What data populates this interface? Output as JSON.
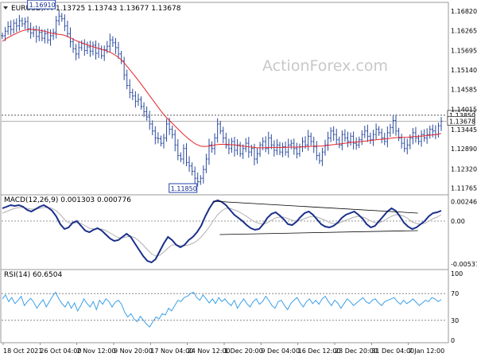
{
  "symbol_header": "EURUSD,H4  1.13725 1.13743 1.13677 1.13678",
  "watermark": "ActionForex.com",
  "colors": {
    "price": "#2b4a9e",
    "ma": "#e8242a",
    "macd_line": "#1a2f8a",
    "macd_signal": "#b0b0b0",
    "rsi": "#3aa0e8",
    "trendline": "#000000",
    "label_box": "#2244aa"
  },
  "chart_data": [
    {
      "type": "line",
      "panel": "price",
      "title": "EURUSD,H4  1.13725 1.13743 1.13677 1.13678",
      "ylim": [
        1.116,
        1.1705
      ],
      "y_ticks": [
        "1.16820",
        "1.16265",
        "1.15695",
        "1.15140",
        "1.14585",
        "1.14015",
        "1.13445",
        "1.12890",
        "1.12320",
        "1.11765"
      ],
      "y_tick_values": [
        1.1682,
        1.16265,
        1.15695,
        1.1514,
        1.14585,
        1.14015,
        1.13445,
        1.1289,
        1.1232,
        1.11765
      ],
      "series": [
        {
          "key": "close",
          "style": "ohlc",
          "values": [
            1.1612,
            1.1625,
            1.1638,
            1.163,
            1.1648,
            1.164,
            1.1655,
            1.1646,
            1.1652,
            1.1632,
            1.162,
            1.1628,
            1.161,
            1.1622,
            1.1605,
            1.1618,
            1.16,
            1.1612,
            1.1622,
            1.1655,
            1.1668,
            1.1661,
            1.164,
            1.1618,
            1.1595,
            1.1575,
            1.156,
            1.1578,
            1.159,
            1.157,
            1.158,
            1.1568,
            1.1585,
            1.1562,
            1.1575,
            1.1555,
            1.1572,
            1.1582,
            1.16,
            1.1592,
            1.1578,
            1.156,
            1.154,
            1.15,
            1.147,
            1.145,
            1.144,
            1.1425,
            1.143,
            1.141,
            1.1395,
            1.138,
            1.136,
            1.134,
            1.132,
            1.1318,
            1.1305,
            1.132,
            1.136,
            1.1345,
            1.133,
            1.13,
            1.127,
            1.126,
            1.129,
            1.125,
            1.124,
            1.1225,
            1.1205,
            1.1195,
            1.1205,
            1.123,
            1.126,
            1.13,
            1.129,
            1.132,
            1.136,
            1.134,
            1.132,
            1.13,
            1.129,
            1.131,
            1.1285,
            1.13,
            1.1275,
            1.129,
            1.1305,
            1.128,
            1.129,
            1.126,
            1.1275,
            1.13,
            1.131,
            1.129,
            1.132,
            1.13,
            1.1285,
            1.13,
            1.128,
            1.1295,
            1.128,
            1.13,
            1.1305,
            1.129,
            1.1275,
            1.1295,
            1.131,
            1.13,
            1.1325,
            1.131,
            1.1295,
            1.127,
            1.1255,
            1.128,
            1.13,
            1.132,
            1.134,
            1.133,
            1.1315,
            1.13,
            1.133,
            1.132,
            1.131,
            1.1325,
            1.1305,
            1.13,
            1.1315,
            1.133,
            1.134,
            1.1325,
            1.1315,
            1.133,
            1.1345,
            1.1335,
            1.132,
            1.131,
            1.1335,
            1.135,
            1.137,
            1.134,
            1.132,
            1.1305,
            1.129,
            1.13,
            1.132,
            1.1335,
            1.132,
            1.131,
            1.133,
            1.132,
            1.133,
            1.1345,
            1.134,
            1.133,
            1.1355,
            1.1368
          ]
        },
        {
          "key": "ma",
          "style": "line",
          "values": [
            1.1596,
            1.1602,
            1.1607,
            1.1611,
            1.1615,
            1.1619,
            1.1623,
            1.1626,
            1.1628,
            1.163,
            1.163,
            1.163,
            1.1629,
            1.1628,
            1.1626,
            1.1625,
            1.1622,
            1.162,
            1.1618,
            1.1617,
            1.1616,
            1.1615,
            1.1613,
            1.161,
            1.1606,
            1.1602,
            1.1598,
            1.1595,
            1.1592,
            1.1589,
            1.1586,
            1.1583,
            1.1581,
            1.1578,
            1.1576,
            1.1573,
            1.1571,
            1.1568,
            1.1565,
            1.1561,
            1.1556,
            1.155,
            1.1543,
            1.1535,
            1.1525,
            1.1515,
            1.1505,
            1.1495,
            1.1485,
            1.1474,
            1.1463,
            1.1452,
            1.1441,
            1.143,
            1.1419,
            1.1408,
            1.1397,
            1.1387,
            1.1378,
            1.137,
            1.1362,
            1.1354,
            1.1346,
            1.1338,
            1.133,
            1.1323,
            1.1316,
            1.131,
            1.1304,
            1.13,
            1.1297,
            1.1296,
            1.1296,
            1.1297,
            1.1298,
            1.13,
            1.1301,
            1.1302,
            1.1302,
            1.1302,
            1.1301,
            1.1301,
            1.13,
            1.1299,
            1.1298,
            1.1297,
            1.1296,
            1.1295,
            1.1294,
            1.1293,
            1.1292,
            1.1292,
            1.1292,
            1.1292,
            1.1293,
            1.1293,
            1.1293,
            1.1293,
            1.1293,
            1.1293,
            1.1293,
            1.1294,
            1.1294,
            1.1294,
            1.1294,
            1.1294,
            1.1295,
            1.1295,
            1.1296,
            1.1296,
            1.1297,
            1.1297,
            1.1297,
            1.1297,
            1.1298,
            1.1299,
            1.13,
            1.1301,
            1.1302,
            1.1303,
            1.1304,
            1.1305,
            1.1306,
            1.1307,
            1.1308,
            1.1308,
            1.1309,
            1.131,
            1.1311,
            1.1312,
            1.1313,
            1.1314,
            1.1315,
            1.1316,
            1.1316,
            1.1317,
            1.1318,
            1.1319,
            1.132,
            1.1321,
            1.1322,
            1.1322,
            1.1322,
            1.1322,
            1.1323,
            1.1324,
            1.1324,
            1.1325,
            1.1325,
            1.1326,
            1.1327,
            1.1328,
            1.1329,
            1.133,
            1.1331,
            1.1333
          ]
        }
      ],
      "levels": [
        {
          "label": "1.13850",
          "value": 1.1385,
          "style": "dotted"
        },
        {
          "label": "1.13678",
          "value": 1.13678,
          "style": "solid"
        }
      ],
      "annotations": [
        {
          "text": "1.16910",
          "at_bar": 19,
          "value": 1.1691
        },
        {
          "text": "1.11850",
          "at_bar": 69,
          "value": 1.1185
        }
      ]
    },
    {
      "type": "line",
      "panel": "macd",
      "title": "MACD(12,26,9) 0.001303 0.000776",
      "ylim": [
        -0.006,
        0.0032
      ],
      "y_ticks": [
        "0.002469",
        "0.00",
        "-0.005375"
      ],
      "y_tick_values": [
        0.002469,
        0.0,
        -0.005375
      ],
      "series": [
        {
          "key": "macd",
          "values": [
            0.0016,
            0.0018,
            0.002,
            0.0019,
            0.002,
            0.0018,
            0.0014,
            0.0012,
            0.0015,
            0.0018,
            0.002,
            0.0017,
            0.0013,
            0.0006,
            -0.0004,
            -0.001,
            -0.0008,
            -0.0002,
            0.0,
            -0.0006,
            -0.0012,
            -0.0014,
            -0.0011,
            -0.0009,
            -0.0012,
            -0.0017,
            -0.0022,
            -0.0025,
            -0.0024,
            -0.002,
            -0.0016,
            -0.002,
            -0.0028,
            -0.0036,
            -0.0044,
            -0.005,
            -0.0052,
            -0.0048,
            -0.0038,
            -0.0028,
            -0.002,
            -0.0024,
            -0.003,
            -0.0033,
            -0.003,
            -0.0024,
            -0.002,
            -0.0014,
            -0.0006,
            0.0006,
            0.0016,
            0.0024,
            0.0026,
            0.0024,
            0.002,
            0.0014,
            0.0008,
            0.0004,
            0.0,
            -0.0005,
            -0.0009,
            -0.0011,
            -0.001,
            -0.0004,
            0.0004,
            0.0009,
            0.0011,
            0.0007,
            0.0002,
            -0.0004,
            -0.0005,
            -0.0001,
            0.0005,
            0.001,
            0.0012,
            0.0008,
            0.0002,
            -0.0004,
            -0.0007,
            -0.0008,
            -0.0006,
            -0.0002,
            0.0004,
            0.0008,
            0.001,
            0.0012,
            0.0008,
            0.0003,
            -0.0004,
            -0.0008,
            -0.0006,
            0.0,
            0.0006,
            0.0012,
            0.0016,
            0.0013,
            0.0006,
            -0.0002,
            -0.0007,
            -0.001,
            -0.0008,
            -0.0004,
            0.0,
            0.0006,
            0.001,
            0.0011,
            0.0013
          ]
        },
        {
          "key": "signal",
          "values": [
            0.001,
            0.0012,
            0.0014,
            0.0016,
            0.0017,
            0.0017,
            0.0016,
            0.0015,
            0.0015,
            0.0016,
            0.0017,
            0.0017,
            0.0016,
            0.0013,
            0.0008,
            0.0002,
            -0.0002,
            -0.0003,
            -0.0002,
            -0.0003,
            -0.0006,
            -0.0009,
            -0.001,
            -0.001,
            -0.001,
            -0.0012,
            -0.0015,
            -0.0018,
            -0.0021,
            -0.0021,
            -0.002,
            -0.0019,
            -0.0021,
            -0.0025,
            -0.003,
            -0.0036,
            -0.0041,
            -0.0044,
            -0.0043,
            -0.0039,
            -0.0034,
            -0.003,
            -0.003,
            -0.0031,
            -0.0031,
            -0.003,
            -0.0028,
            -0.0025,
            -0.002,
            -0.0014,
            -0.0007,
            0.0001,
            0.0008,
            0.0013,
            0.0016,
            0.0016,
            0.0014,
            0.0012,
            0.0009,
            0.0006,
            0.0002,
            -0.0001,
            -0.0003,
            -0.0004,
            -0.0002,
            0.0001,
            0.0004,
            0.0005,
            0.0005,
            0.0003,
            0.0001,
            0.0,
            0.0001,
            0.0003,
            0.0005,
            0.0006,
            0.0005,
            0.0003,
            0.0001,
            -0.0002,
            -0.0003,
            -0.0003,
            -0.0001,
            0.0001,
            0.0003,
            0.0005,
            0.0006,
            0.0005,
            0.0003,
            0.0,
            -0.0002,
            -0.0002,
            0.0,
            0.0003,
            0.0006,
            0.0008,
            0.0008,
            0.0006,
            0.0003,
            -0.0001,
            -0.0003,
            -0.0004,
            -0.0003,
            0.0,
            0.0003,
            0.0005,
            0.0008
          ]
        }
      ],
      "trendlines": [
        {
          "from": [
            0.475,
            0.0025
          ],
          "to": [
            0.935,
            0.001
          ]
        },
        {
          "from": [
            0.49,
            -0.0017
          ],
          "to": [
            0.935,
            -0.0012
          ]
        }
      ]
    },
    {
      "type": "line",
      "panel": "rsi",
      "title": "RSI(14) 60.6504",
      "ylim": [
        0,
        100
      ],
      "y_ticks": [
        "100",
        "70",
        "30",
        "0"
      ],
      "y_tick_values": [
        100,
        70,
        30,
        0
      ],
      "levels": [
        70,
        30
      ],
      "series": [
        {
          "key": "rsi",
          "values": [
            62,
            68,
            58,
            64,
            55,
            60,
            66,
            52,
            58,
            63,
            57,
            48,
            55,
            61,
            50,
            58,
            66,
            72,
            62,
            55,
            50,
            58,
            48,
            56,
            44,
            52,
            62,
            55,
            50,
            58,
            46,
            60,
            54,
            62,
            58,
            50,
            57,
            60,
            54,
            42,
            35,
            40,
            32,
            28,
            36,
            30,
            24,
            20,
            28,
            35,
            32,
            40,
            38,
            48,
            44,
            52,
            60,
            58,
            64,
            66,
            70,
            72,
            64,
            60,
            68,
            62,
            56,
            62,
            55,
            64,
            58,
            62,
            56,
            52,
            60,
            48,
            56,
            62,
            55,
            50,
            58,
            62,
            54,
            58,
            66,
            60,
            52,
            48,
            58,
            60,
            52,
            46,
            55,
            60,
            64,
            56,
            50,
            58,
            62,
            55,
            60,
            54,
            62,
            66,
            58,
            52,
            60,
            56,
            48,
            55,
            62,
            58,
            52,
            56,
            60,
            64,
            58,
            55,
            60,
            62,
            56,
            52,
            58,
            60,
            62,
            64,
            58,
            54,
            60,
            55,
            58,
            62,
            57,
            52,
            56,
            60,
            58,
            64,
            62,
            58,
            61
          ]
        }
      ],
      "x_tick_labels": [
        "18 Oct 2021",
        "26 Oct 04:00",
        "2 Nov 12:00",
        "9 Nov 20:00",
        "17 Nov 04:00",
        "24 Nov 12:00",
        "1 Dec 20:00",
        "9 Dec 04:00",
        "16 Dec 12:00",
        "23 Dec 20:00",
        "31 Dec 04:00",
        "7 Jan 12:00"
      ]
    }
  ]
}
